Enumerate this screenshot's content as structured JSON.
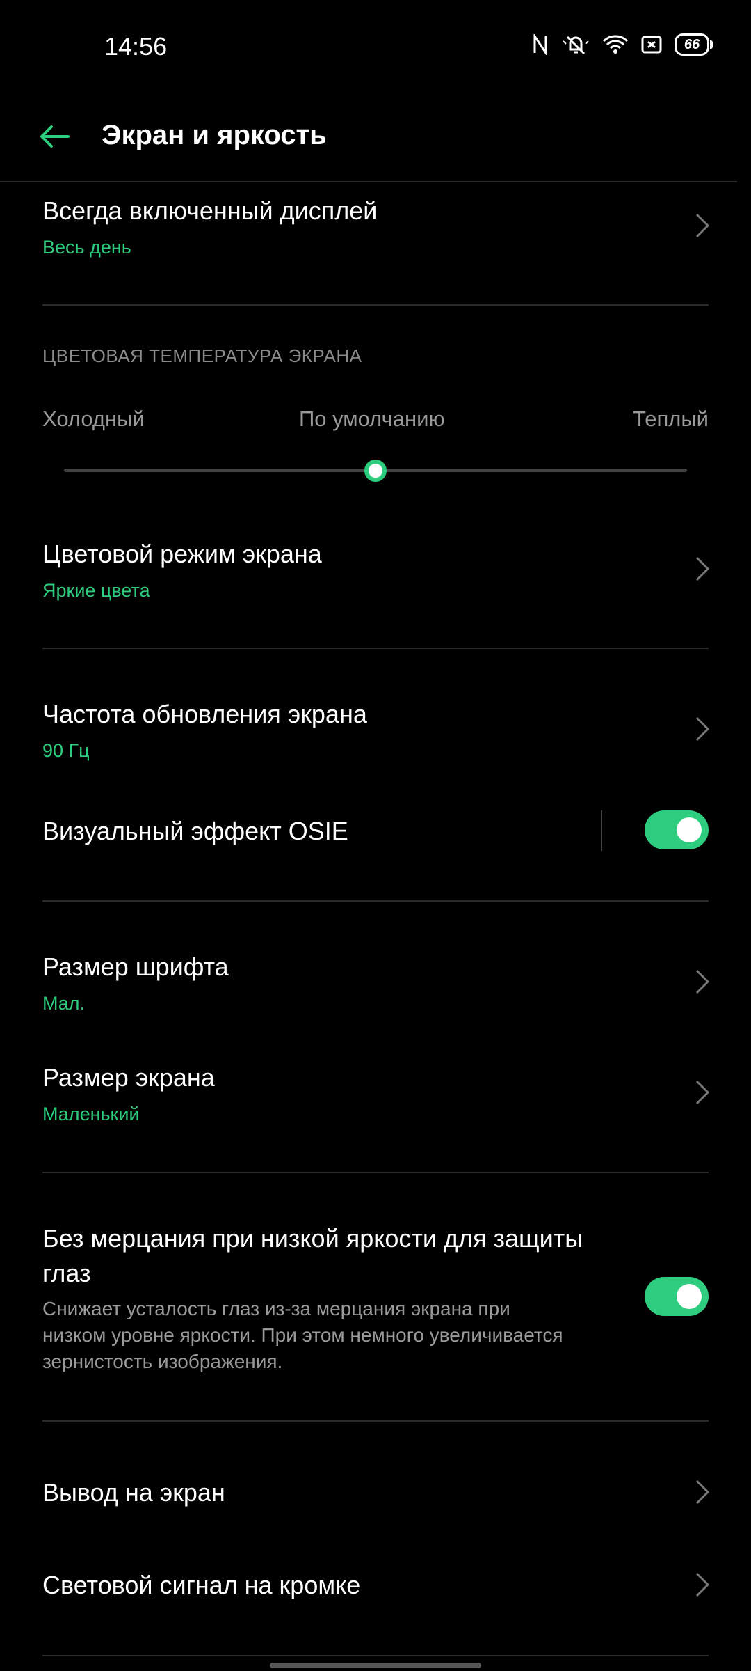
{
  "status_bar": {
    "time": "14:56",
    "battery": "66",
    "icons": [
      "nfc-icon",
      "silent-bell-icon",
      "wifi-icon",
      "sim-icon",
      "battery-icon"
    ]
  },
  "header": {
    "title": "Экран и яркость",
    "back_icon": "back-arrow-icon"
  },
  "always_on": {
    "title": "Всегда включенный дисплей",
    "value": "Весь день"
  },
  "color_temp": {
    "section_label": "ЦВЕТОВАЯ ТЕМПЕРАТУРА ЭКРАНА",
    "left_label": "Холодный",
    "center_label": "По умолчанию",
    "right_label": "Теплый",
    "slider_level": 0.5
  },
  "color_mode": {
    "title": "Цветовой режим экрана",
    "value": "Яркие цвета"
  },
  "refresh_rate": {
    "title": "Частота обновления экрана",
    "value": "90 Гц"
  },
  "osie": {
    "title": "Визуальный эффект OSIE",
    "enabled": true
  },
  "font_size": {
    "title": "Размер шрифта",
    "value": "Мал."
  },
  "screen_size": {
    "title": "Размер экрана",
    "value": "Маленький"
  },
  "flicker": {
    "title_line1": "Без мерцания при низкой яркости для защиты",
    "title_line2": "глаз",
    "desc_line1": "Снижает усталость глаз из-за мерцания экрана при",
    "desc_line2": "низком уровне яркости. При этом немного увеличивается",
    "desc_line3": "зернистость изображения.",
    "enabled": true
  },
  "screen_cast": {
    "title": "Вывод на экран"
  },
  "edge_light": {
    "title": "Световой сигнал на кромке"
  },
  "colors": {
    "accent": "#2ecc7e",
    "background": "#000000"
  }
}
